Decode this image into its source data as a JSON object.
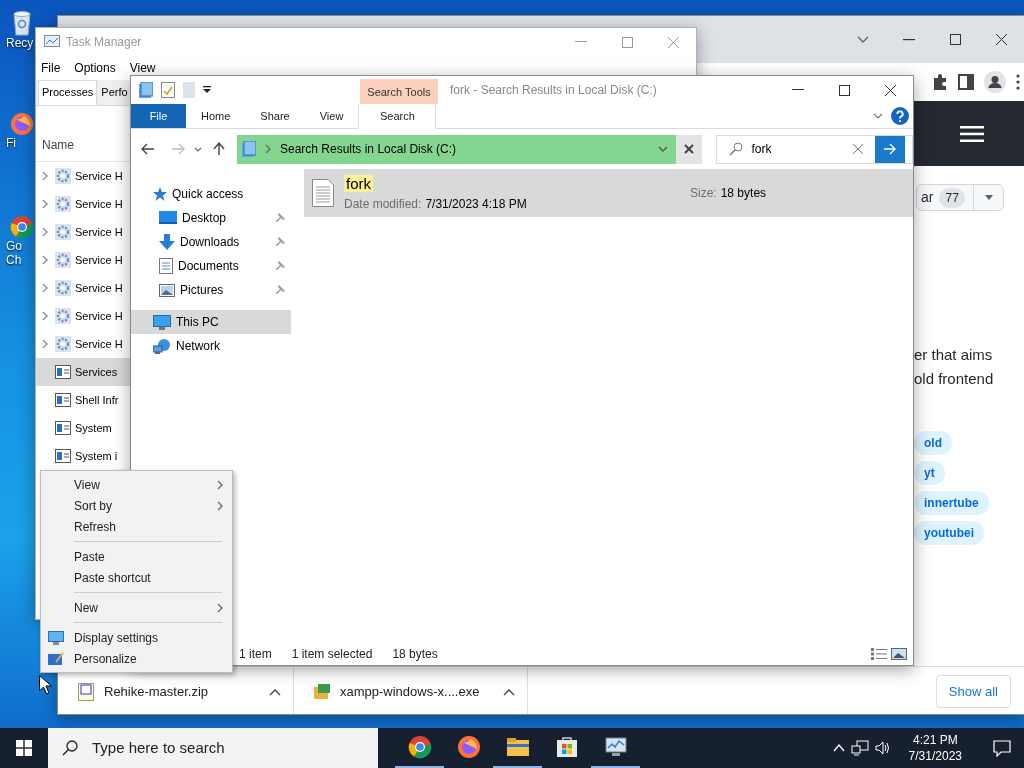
{
  "desktop_icons": [
    {
      "kind": "recycle",
      "lines": [
        "Recy"
      ]
    },
    {
      "kind": "firefox",
      "lines": [
        "Fi"
      ]
    },
    {
      "kind": "chrome",
      "lines": [
        "Go",
        "Ch"
      ]
    }
  ],
  "browser": {
    "star_button": {
      "label": "ar",
      "count": "77"
    },
    "description": [
      "er that aims",
      "old frontend"
    ],
    "tags": [
      "old",
      "yt",
      "innertube",
      "youtubei"
    ],
    "downloads": [
      {
        "name": "Rehike-master.zip",
        "kind": "zip"
      },
      {
        "name": "xampp-windows-x....exe",
        "kind": "exe"
      }
    ],
    "show_all": "Show all"
  },
  "task_manager": {
    "title": "Task Manager",
    "menu": [
      "File",
      "Options",
      "View"
    ],
    "tabs": [
      {
        "label": "Processes",
        "selected": true
      },
      {
        "label": "Perfo",
        "selected": false
      }
    ],
    "column": "Name",
    "rows": [
      {
        "name": "Service H",
        "kind": "service",
        "expandable": true,
        "selected": false
      },
      {
        "name": "Service H",
        "kind": "service",
        "expandable": true,
        "selected": false
      },
      {
        "name": "Service H",
        "kind": "service",
        "expandable": true,
        "selected": false
      },
      {
        "name": "Service H",
        "kind": "service",
        "expandable": true,
        "selected": false
      },
      {
        "name": "Service H",
        "kind": "service",
        "expandable": true,
        "selected": false
      },
      {
        "name": "Service H",
        "kind": "service",
        "expandable": true,
        "selected": false
      },
      {
        "name": "Service H",
        "kind": "service",
        "expandable": true,
        "selected": false
      },
      {
        "name": "Services",
        "kind": "app",
        "expandable": false,
        "selected": true
      },
      {
        "name": "Shell Infr",
        "kind": "app",
        "expandable": false,
        "selected": false
      },
      {
        "name": "System",
        "kind": "app",
        "expandable": false,
        "selected": false
      },
      {
        "name": "System i",
        "kind": "app",
        "expandable": false,
        "selected": false
      }
    ]
  },
  "explorer": {
    "title": "fork - Search Results in Local Disk (C:)",
    "context_tab": "Search Tools",
    "ribbon_tabs": [
      {
        "label": "File",
        "kind": "file"
      },
      {
        "label": "Home",
        "kind": "tab"
      },
      {
        "label": "Share",
        "kind": "tab"
      },
      {
        "label": "View",
        "kind": "tab"
      },
      {
        "label": "Search",
        "kind": "context"
      }
    ],
    "address": "Search Results in Local Disk (C:)",
    "search": {
      "value": "fork"
    },
    "nav": [
      {
        "label": "Quick access",
        "kind": "star",
        "selected": false,
        "children": [
          {
            "label": "Desktop",
            "kind": "desktop",
            "pinned": true,
            "selected": false
          },
          {
            "label": "Downloads",
            "kind": "download",
            "pinned": true,
            "selected": false
          },
          {
            "label": "Documents",
            "kind": "document",
            "pinned": true,
            "selected": false
          },
          {
            "label": "Pictures",
            "kind": "picture",
            "pinned": true,
            "selected": false
          }
        ]
      },
      {
        "label": "This PC",
        "kind": "pc",
        "selected": true
      },
      {
        "label": "Network",
        "kind": "network",
        "selected": false
      }
    ],
    "results": [
      {
        "name": "fork",
        "date_label": "Date modified:",
        "date": "7/31/2023 4:18 PM",
        "size_label": "Size:",
        "size": "18 bytes",
        "selected": true
      }
    ],
    "status": {
      "count": "1 item",
      "selection": "1 item selected",
      "size": "18 bytes"
    }
  },
  "context_menu": [
    {
      "kind": "item",
      "label": "View",
      "submenu": true
    },
    {
      "kind": "item",
      "label": "Sort by",
      "submenu": true
    },
    {
      "kind": "item",
      "label": "Refresh",
      "submenu": false
    },
    {
      "kind": "separator"
    },
    {
      "kind": "item",
      "label": "Paste",
      "submenu": false
    },
    {
      "kind": "item",
      "label": "Paste shortcut",
      "submenu": false
    },
    {
      "kind": "separator"
    },
    {
      "kind": "item",
      "label": "New",
      "submenu": true
    },
    {
      "kind": "separator"
    },
    {
      "kind": "display",
      "label": "Display settings",
      "submenu": false
    },
    {
      "kind": "personalize",
      "label": "Personalize",
      "submenu": false
    }
  ],
  "taskbar": {
    "search_placeholder": "Type here to search",
    "apps": [
      {
        "kind": "chrome",
        "running": true
      },
      {
        "kind": "firefox",
        "running": false
      },
      {
        "kind": "folder",
        "running": true
      },
      {
        "kind": "store",
        "running": false
      },
      {
        "kind": "monitor",
        "running": true
      }
    ],
    "time": "4:21 PM",
    "date": "7/31/2023"
  }
}
